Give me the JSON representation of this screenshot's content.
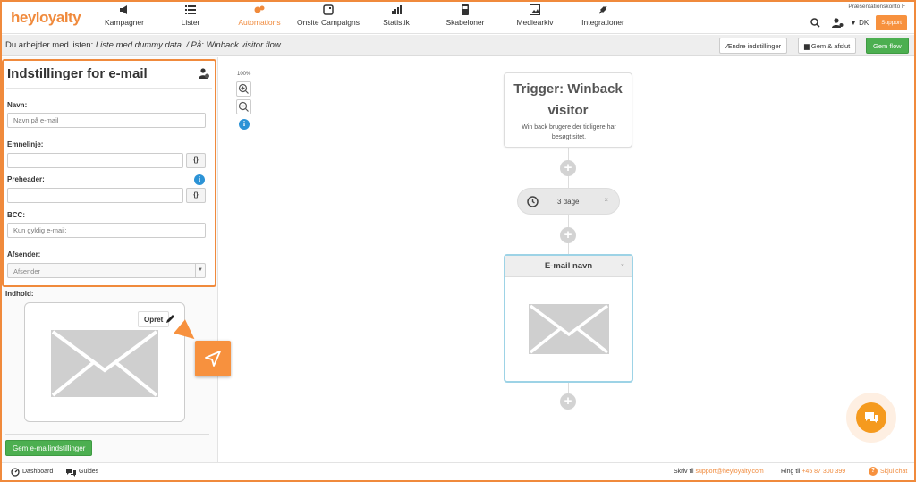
{
  "brand": {
    "name_left": "hey",
    "name_right": "loyalty"
  },
  "nav": {
    "items": [
      {
        "label": "Kampagner",
        "icon": "megaphone-icon"
      },
      {
        "label": "Lister",
        "icon": "list-icon"
      },
      {
        "label": "Automations",
        "icon": "automation-icon",
        "active": true
      },
      {
        "label": "Onsite Campaigns",
        "icon": "onsite-icon"
      },
      {
        "label": "Statistik",
        "icon": "chart-icon"
      },
      {
        "label": "Skabeloner",
        "icon": "template-icon"
      },
      {
        "label": "Mediearkiv",
        "icon": "image-icon"
      },
      {
        "label": "Integrationer",
        "icon": "plug-icon"
      }
    ],
    "account_name": "Præsentationskonto F",
    "language": "DK",
    "support_label": "Support"
  },
  "subbar": {
    "prefix": "Du arbejder med listen: ",
    "list_name": "Liste med dummy data",
    "separator": "  / På: ",
    "flow_name": "Winback visitor flow",
    "change_settings_label": "Ændre indstillinger",
    "save_close_label": "Gem & afslut",
    "save_flow_label": "Gem flow"
  },
  "email_settings": {
    "title": "Indstillinger for e-mail",
    "name_label": "Navn:",
    "name_placeholder": "Navn på e-mail",
    "subject_label": "Emnelinje:",
    "subject_value": "",
    "preheader_label": "Preheader:",
    "preheader_value": "",
    "bcc_label": "BCC:",
    "bcc_placeholder": "Kun gyldig e-mail:",
    "sender_label": "Afsender:",
    "sender_selected": "Afsender",
    "brace_label": "{}"
  },
  "content": {
    "label": "Indhold:",
    "create_label": "Opret",
    "save_settings_label": "Gem e-mailindstillinger"
  },
  "canvas": {
    "zoom_level": "100%",
    "trigger_title": "Trigger: Winback visitor",
    "trigger_desc": "Win back brugere der tidligere har besøgt sitet.",
    "delay_label": "3 dage",
    "email_node_title": "E-mail navn",
    "close_symbol": "×",
    "plus_symbol": "+"
  },
  "footer": {
    "dashboard": "Dashboard",
    "guides": "Guides",
    "write_to": "Skriv til ",
    "email": "support@heyloyalty.com",
    "call": "Ring til ",
    "phone": "+45 87 300 399",
    "hide_chat": "Skjul chat"
  },
  "colors": {
    "accent": "#f08a3c",
    "green": "#4caf50",
    "info": "#2c93d6",
    "node_border": "#9dd3e6"
  }
}
